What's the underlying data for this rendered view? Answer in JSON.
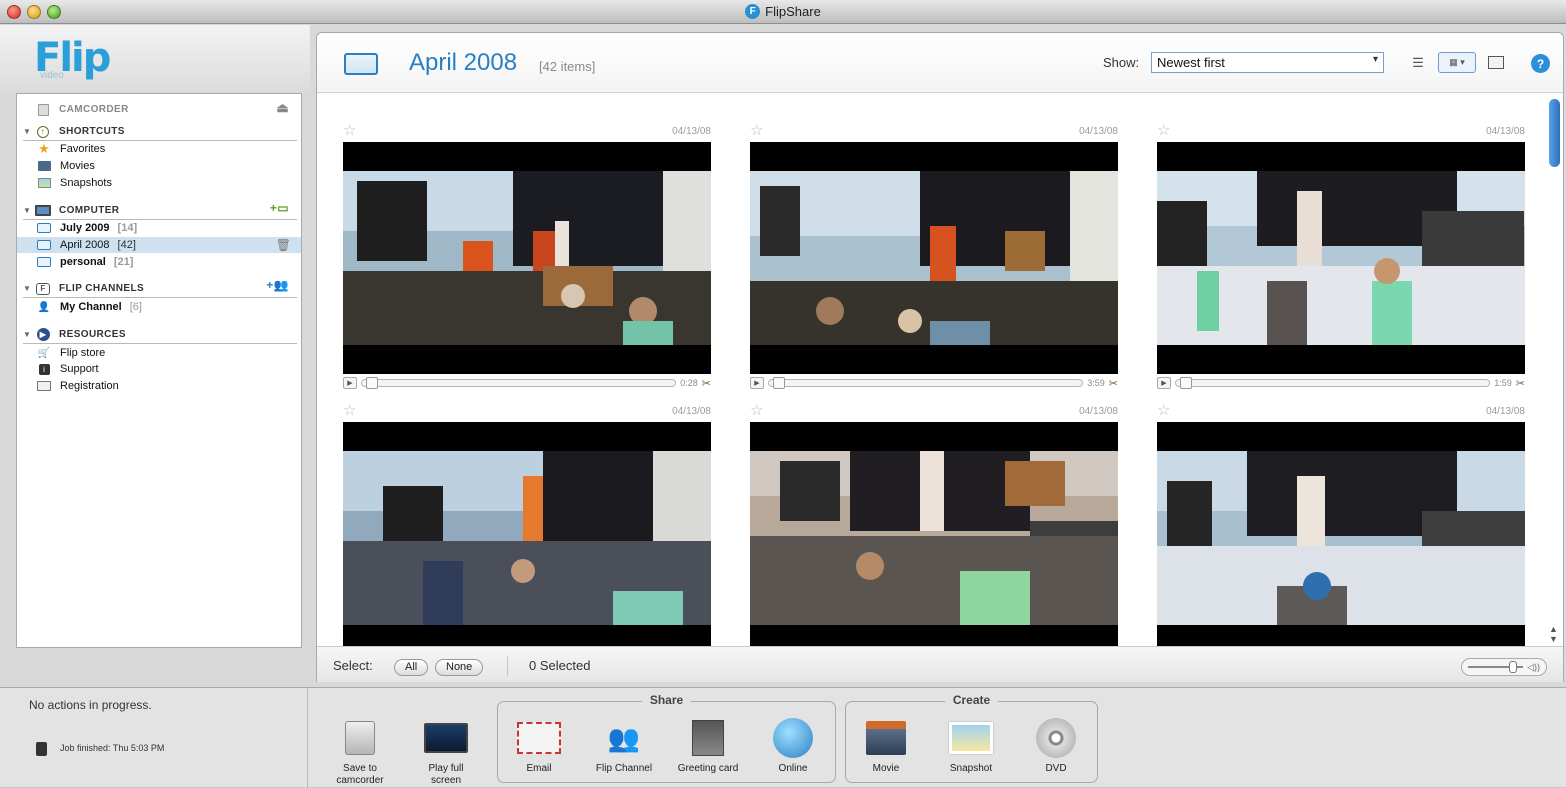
{
  "window": {
    "title": "FlipShare"
  },
  "logo": {
    "brand": "Flip",
    "sub": "video"
  },
  "sidebar": {
    "camcorder": {
      "label": "CAMCORDER"
    },
    "shortcuts": {
      "label": "SHORTCUTS",
      "items": [
        {
          "label": "Favorites"
        },
        {
          "label": "Movies"
        },
        {
          "label": "Snapshots"
        }
      ]
    },
    "computer": {
      "label": "COMPUTER",
      "items": [
        {
          "label": "July 2009",
          "count": "[14]"
        },
        {
          "label": "April 2008",
          "count": "[42]",
          "selected": true
        },
        {
          "label": "personal",
          "count": "[21]"
        }
      ]
    },
    "channels": {
      "label": "FLIP CHANNELS",
      "items": [
        {
          "label": "My Channel",
          "count": "[6]"
        }
      ]
    },
    "resources": {
      "label": "RESOURCES",
      "items": [
        {
          "label": "Flip store"
        },
        {
          "label": "Support"
        },
        {
          "label": "Registration"
        }
      ]
    }
  },
  "header": {
    "title": "April 2008",
    "items": "[42 items]",
    "show_label": "Show:",
    "sort_value": "Newest first",
    "help": "?"
  },
  "videos": [
    {
      "date": "04/13/08",
      "duration": "0:28"
    },
    {
      "date": "04/13/08",
      "duration": "3:59"
    },
    {
      "date": "04/13/08",
      "duration": "1:59"
    },
    {
      "date": "04/13/08",
      "duration": ""
    },
    {
      "date": "04/13/08",
      "duration": ""
    },
    {
      "date": "04/13/08",
      "duration": ""
    }
  ],
  "selectbar": {
    "label": "Select:",
    "all": "All",
    "none": "None",
    "selected": "0 Selected"
  },
  "status": {
    "text": "No actions in progress.",
    "job": "Job finished: Thu 5:03 PM"
  },
  "toolbar": {
    "save": "Save to camcorder",
    "play": "Play full screen",
    "share_label": "Share",
    "email": "Email",
    "flip_channel": "Flip Channel",
    "greeting": "Greeting card",
    "online": "Online",
    "create_label": "Create",
    "movie": "Movie",
    "snapshot": "Snapshot",
    "dvd": "DVD"
  },
  "colors": {
    "accent": "#2a7fc4",
    "selection": "#cfe0f0"
  }
}
